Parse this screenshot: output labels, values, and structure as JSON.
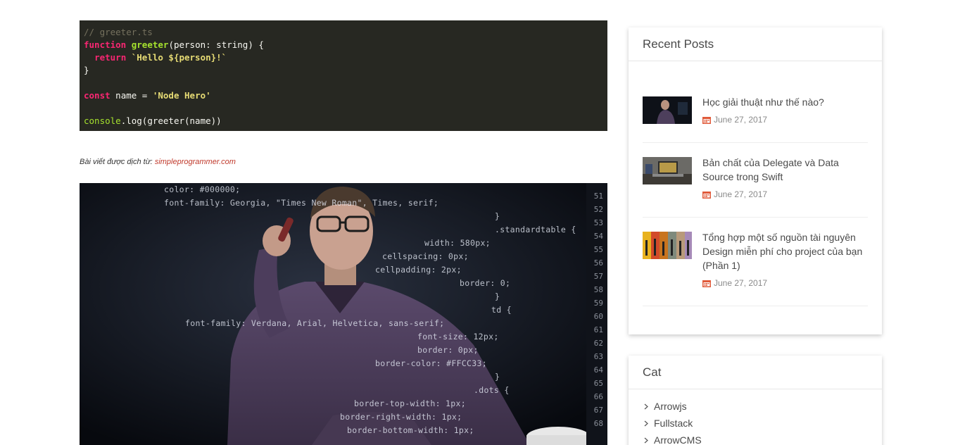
{
  "code_block": {
    "lines": [
      [
        {
          "t": "// greeter.ts",
          "c": "comment"
        }
      ],
      [
        {
          "t": "function",
          "c": "keyword"
        },
        {
          "t": " ",
          "c": "plain"
        },
        {
          "t": "greeter",
          "c": "func"
        },
        {
          "t": "(person: string) {",
          "c": "plain"
        }
      ],
      [
        {
          "t": "  ",
          "c": "plain"
        },
        {
          "t": "return",
          "c": "keyword"
        },
        {
          "t": " ",
          "c": "plain"
        },
        {
          "t": "`Hello ${person}!`",
          "c": "string"
        }
      ],
      [
        {
          "t": "}",
          "c": "plain"
        }
      ],
      [
        {
          "t": "",
          "c": "plain"
        }
      ],
      [
        {
          "t": "const",
          "c": "keyword"
        },
        {
          "t": " name = ",
          "c": "plain"
        },
        {
          "t": "'Node Hero'",
          "c": "string"
        }
      ],
      [
        {
          "t": "",
          "c": "plain"
        }
      ],
      [
        {
          "t": "console",
          "c": "ident"
        },
        {
          "t": ".log(greeter(name))",
          "c": "plain"
        }
      ]
    ]
  },
  "translation_note": {
    "prefix": "Bài viết được dịch từ: ",
    "link_text": "simpleprogrammer.com"
  },
  "hero_image": {
    "code_lines": [
      "color: #000000;",
      "font-family: Georgia, \"Times New Roman\", Times, serif;",
      "}",
      ".standardtable {",
      "width: 580px;",
      "cellspacing: 0px;",
      "cellpadding: 2px;",
      "border: 0;",
      "}",
      "td {",
      "font-family: Verdana, Arial, Helvetica, sans-serif;",
      "font-size: 12px;",
      "border: 0px;",
      "border-color: #FFCC33;",
      "}",
      ".dots {",
      "border-top-width: 1px;",
      "border-right-width: 1px;",
      "border-bottom-width: 1px;"
    ],
    "gutter_numbers": [
      "51",
      "52",
      "53",
      "54",
      "55",
      "56",
      "57",
      "58",
      "59",
      "60",
      "61",
      "62",
      "63",
      "64",
      "65",
      "66",
      "67",
      "68"
    ]
  },
  "recent_posts": {
    "title": "Recent Posts",
    "posts": [
      {
        "title": "Học giải thuật như thế nào?",
        "date": "June 27, 2017",
        "thumb": "person-at-computer"
      },
      {
        "title": "Bản chất của Delegate và Data Source trong Swift",
        "date": "June 27, 2017",
        "thumb": "laptop-desk"
      },
      {
        "title": "Tổng hợp một số nguồn tài nguyên Design miễn phí cho project của bạn (Phần 1)",
        "date": "June 27, 2017",
        "thumb": "color-pencils"
      }
    ]
  },
  "categories": {
    "title": "Cat",
    "items": [
      "Arrowjs",
      "Fullstack",
      "ArrowCMS"
    ]
  },
  "colors": {
    "code_bg": "#272822",
    "accent_link": "#c0392b",
    "date_icon": "#e05a3a"
  }
}
